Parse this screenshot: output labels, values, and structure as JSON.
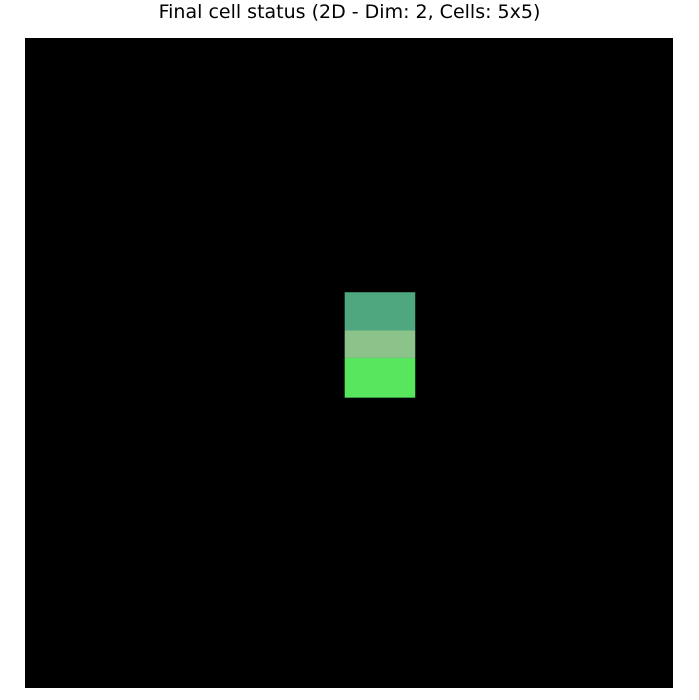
{
  "chart_data": {
    "type": "heatmap",
    "title": "Final cell status (2D - Dim: 2, Cells: 5x5)",
    "xlabel": "",
    "ylabel": "",
    "axes_visible": false,
    "grid": false,
    "background_color": "#000000",
    "domain": {
      "x": [
        0,
        9
      ],
      "y": [
        0,
        9
      ]
    },
    "cells": [
      {
        "x0": 4.44,
        "x1": 5.42,
        "y0": 5.48,
        "y1": 4.95,
        "color": "#4fa77f"
      },
      {
        "x0": 4.44,
        "x1": 5.42,
        "y0": 4.95,
        "y1": 4.57,
        "color": "#8cc38a"
      },
      {
        "x0": 4.44,
        "x1": 5.42,
        "y0": 4.57,
        "y1": 4.02,
        "color": "#58e65e"
      }
    ]
  }
}
